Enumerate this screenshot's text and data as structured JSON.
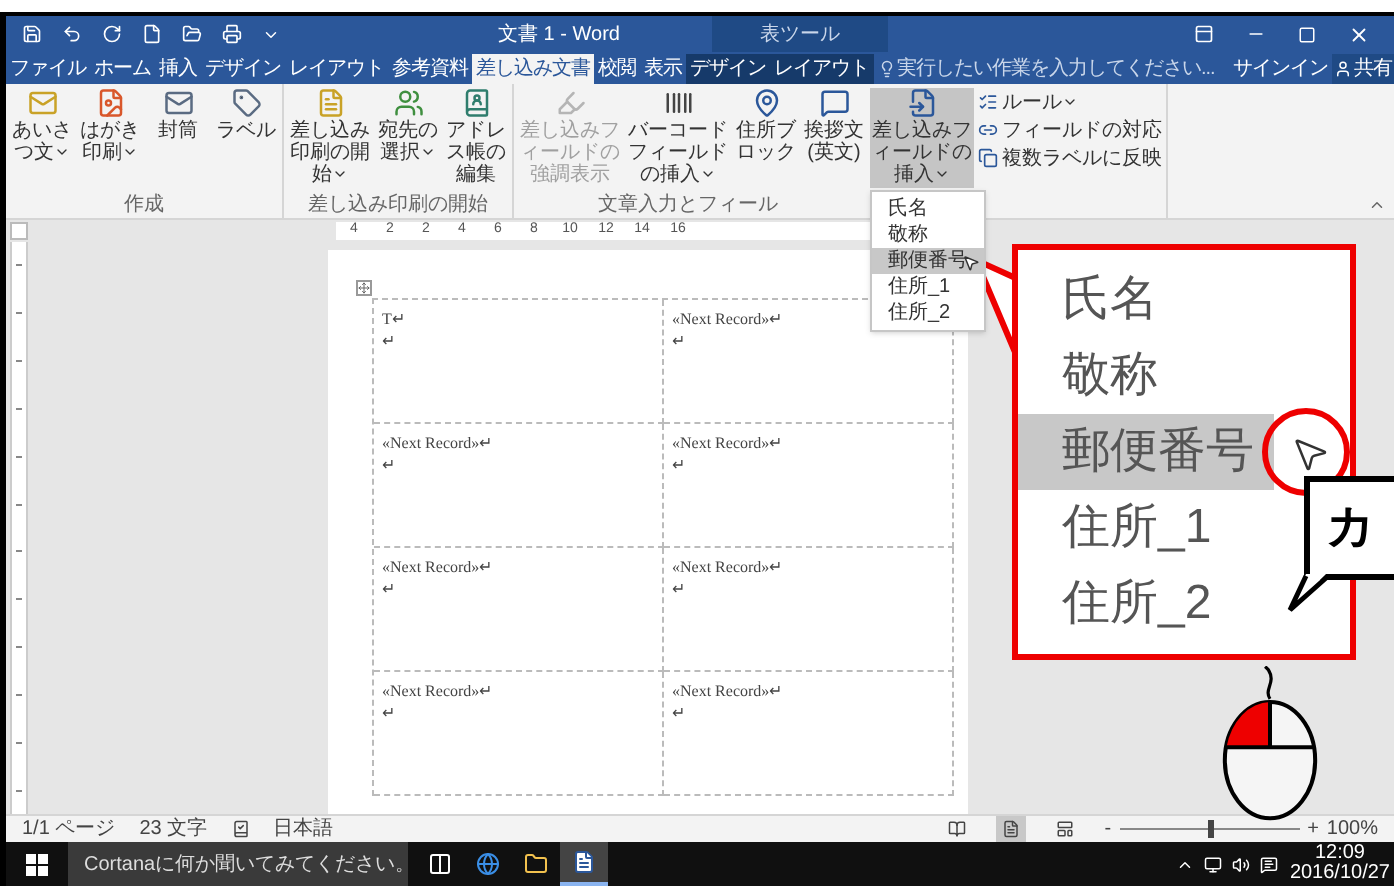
{
  "window": {
    "title": "文書 1 - Word",
    "context_group": "表ツール",
    "sign_in": "サインイン",
    "share": "共有"
  },
  "tabs": [
    {
      "label": "ファイル",
      "selected": false,
      "contextual": false
    },
    {
      "label": "ホーム",
      "selected": false,
      "contextual": false
    },
    {
      "label": "挿入",
      "selected": false,
      "contextual": false
    },
    {
      "label": "デザイン",
      "selected": false,
      "contextual": false
    },
    {
      "label": "レイアウト",
      "selected": false,
      "contextual": false
    },
    {
      "label": "参考資料",
      "selected": false,
      "contextual": false
    },
    {
      "label": "差し込み文書",
      "selected": true,
      "contextual": false
    },
    {
      "label": "校閲",
      "selected": false,
      "contextual": false
    },
    {
      "label": "表示",
      "selected": false,
      "contextual": false
    },
    {
      "label": "デザイン",
      "selected": false,
      "contextual": true
    },
    {
      "label": "レイアウト",
      "selected": false,
      "contextual": true
    }
  ],
  "tell_me": {
    "placeholder": "実行したい作業を入力してください..."
  },
  "ribbon": {
    "groups": [
      {
        "label": "作成",
        "buttons": [
          {
            "label": "あいさつ文",
            "dropdown": true,
            "disabled": false,
            "pressed": false
          },
          {
            "label": "はがき印刷",
            "dropdown": true,
            "disabled": false,
            "pressed": false
          },
          {
            "label": "封筒",
            "dropdown": false,
            "disabled": false,
            "pressed": false
          },
          {
            "label": "ラベル",
            "dropdown": false,
            "disabled": false,
            "pressed": false
          }
        ]
      },
      {
        "label": "差し込み印刷の開始",
        "buttons": [
          {
            "label": "差し込み印刷の開始",
            "dropdown": true,
            "disabled": false,
            "pressed": false
          },
          {
            "label": "宛先の選択",
            "dropdown": true,
            "disabled": false,
            "pressed": false
          },
          {
            "label": "アドレス帳の編集",
            "dropdown": false,
            "disabled": false,
            "pressed": false
          }
        ]
      },
      {
        "label": "文章入力とフィール",
        "buttons": [
          {
            "label": "差し込みフィールドの強調表示",
            "dropdown": false,
            "disabled": true,
            "pressed": false
          },
          {
            "label": "バーコードフィールドの挿入",
            "dropdown": true,
            "disabled": false,
            "pressed": false
          },
          {
            "label": "住所ブロック",
            "dropdown": false,
            "disabled": false,
            "pressed": false
          },
          {
            "label": "挨拶文(英文)",
            "dropdown": false,
            "disabled": false,
            "pressed": false
          },
          {
            "label": "差し込みフィールドの挿入",
            "dropdown": true,
            "disabled": false,
            "pressed": true
          }
        ],
        "small_buttons": [
          {
            "label": "ルール",
            "dropdown": true
          },
          {
            "label": "フィールドの対応",
            "dropdown": false
          },
          {
            "label": "複数ラベルに反映",
            "dropdown": false
          }
        ]
      }
    ]
  },
  "field_menu": {
    "items": [
      {
        "label": "氏名",
        "selected": false
      },
      {
        "label": "敬称",
        "selected": false
      },
      {
        "label": "郵便番号",
        "selected": true
      },
      {
        "label": "住所_1",
        "selected": false
      },
      {
        "label": "住所_2",
        "selected": false
      }
    ]
  },
  "ruler": {
    "marks": [
      "4",
      "2",
      "2",
      "4",
      "6",
      "8",
      "10",
      "12",
      "14",
      "16"
    ]
  },
  "document": {
    "cells": [
      {
        "lines": [
          "T↵",
          "↵"
        ]
      },
      {
        "lines": [
          "«Next Record»↵",
          "↵"
        ]
      },
      {
        "lines": [
          "«Next Record»↵",
          "↵"
        ]
      },
      {
        "lines": [
          "«Next Record»↵",
          "↵"
        ]
      },
      {
        "lines": [
          "«Next Record»↵",
          "↵"
        ]
      },
      {
        "lines": [
          "«Next Record»↵",
          "↵"
        ]
      },
      {
        "lines": [
          "«Next Record»↵",
          "↵"
        ]
      },
      {
        "lines": [
          "«Next Record»↵",
          "↵"
        ]
      }
    ]
  },
  "status_bar": {
    "page": "1/1 ページ",
    "words": "23 文字",
    "language": "日本語",
    "views": [
      {
        "selected": false
      },
      {
        "selected": true
      },
      {
        "selected": false
      }
    ],
    "zoom_out": "-",
    "zoom": {
      "level": 0.5
    },
    "zoom_in": "+",
    "zoom_label": "100%"
  },
  "taskbar": {
    "search_placeholder": "Cortanaに何か聞いてみてください。",
    "apps": [
      {
        "selected": false
      },
      {
        "selected": false
      },
      {
        "selected": false
      },
      {
        "selected": true
      }
    ],
    "time": "12:09",
    "date": "2016/10/27"
  },
  "callout": {
    "items": [
      {
        "label": "氏名",
        "selected": false
      },
      {
        "label": "敬称",
        "selected": false
      },
      {
        "label": "郵便番号",
        "selected": true
      },
      {
        "label": "住所_1",
        "selected": false
      },
      {
        "label": "住所_2",
        "selected": false
      }
    ]
  },
  "mouse": {
    "left_pressed": true
  },
  "speech_bubble": {
    "text": "カ"
  }
}
